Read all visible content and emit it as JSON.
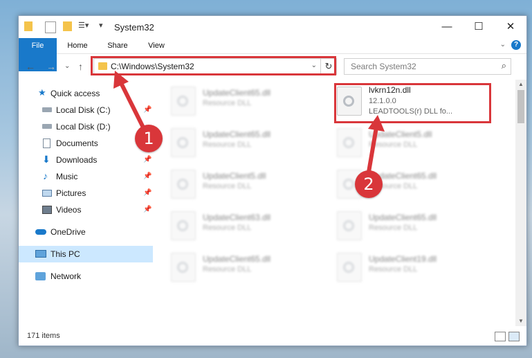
{
  "window": {
    "title": "System32"
  },
  "ribbon": {
    "tabs": [
      "File",
      "Home",
      "Share",
      "View"
    ],
    "help": "?"
  },
  "address": {
    "path": "C:\\Windows\\System32"
  },
  "search": {
    "placeholder": "Search System32"
  },
  "nav": {
    "items": [
      {
        "label": "Quick access",
        "icon": "star-icon"
      },
      {
        "label": "Local Disk (C:)",
        "icon": "drive-icon"
      },
      {
        "label": "Local Disk (D:)",
        "icon": "drive-icon"
      },
      {
        "label": "Documents",
        "icon": "document-icon"
      },
      {
        "label": "Downloads",
        "icon": "download-icon"
      },
      {
        "label": "Music",
        "icon": "music-icon"
      },
      {
        "label": "Pictures",
        "icon": "picture-icon"
      },
      {
        "label": "Videos",
        "icon": "video-icon"
      },
      {
        "label": "OneDrive",
        "icon": "cloud-icon"
      },
      {
        "label": "This PC",
        "icon": "computer-icon"
      },
      {
        "label": "Network",
        "icon": "network-icon"
      }
    ]
  },
  "files": {
    "highlighted": {
      "name": "lvkrn12n.dll",
      "version": "12.1.0.0",
      "description": "LEADTOOLS(r) DLL fo..."
    },
    "left": [
      {
        "name": "UpdateClient65.dll",
        "type": "Resource DLL"
      },
      {
        "name": "UpdateClient65.dll",
        "type": "Resource DLL"
      },
      {
        "name": "UpdateClient5.dll",
        "type": "Resource DLL"
      },
      {
        "name": "UpdateClient63.dll",
        "type": "Resource DLL"
      },
      {
        "name": "UpdateClient65.dll",
        "type": "Resource DLL"
      }
    ],
    "right": [
      {
        "name": "UpdateClient5.dll",
        "type": "Resource DLL"
      },
      {
        "name": "UpdateClient65.dll",
        "type": "Resource DLL"
      },
      {
        "name": "UpdateClient65.dll",
        "type": "Resource DLL"
      },
      {
        "name": "UpdateClient19.dll",
        "type": "Resource DLL"
      }
    ]
  },
  "status": {
    "item_count": "171 items"
  },
  "annotations": {
    "step1": "1",
    "step2": "2",
    "color": "#d9363a"
  }
}
